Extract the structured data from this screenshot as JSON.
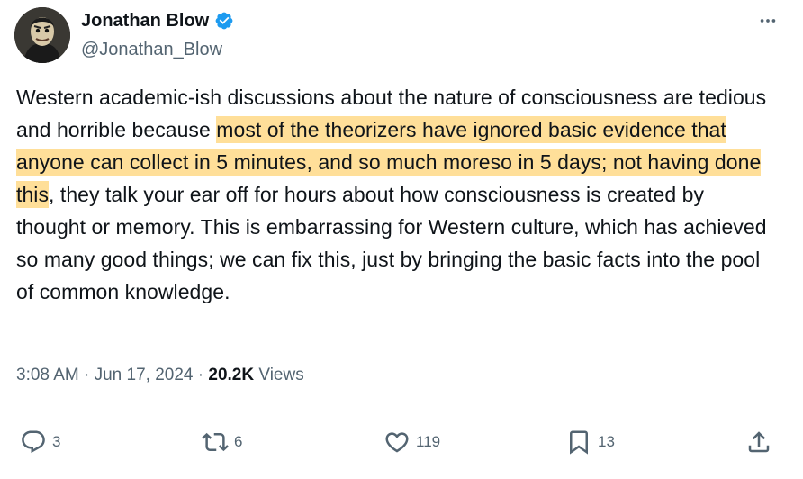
{
  "author": {
    "display_name": "Jonathan Blow",
    "handle": "@Jonathan_Blow",
    "verified_color": "#1d9bf0"
  },
  "tweet": {
    "text_before": "Western academic-ish discussions about the nature of consciousness are tedious and horrible because ",
    "text_highlight": "most of the theorizers have ignored basic evidence that anyone can collect in 5 minutes, and so much moreso in 5 days; not having done this",
    "text_after": ", they talk your ear off for hours about how consciousness is created by thought or memory. This is embarrassing for Western culture, which has achieved so many good things; we can fix this, just by bringing the basic facts into the pool of common knowledge.",
    "highlight_color": "#ffdf99"
  },
  "meta": {
    "time": "3:08 AM",
    "separator": "·",
    "date": "Jun 17, 2024",
    "views_count": "20.2K",
    "views_label": "Views"
  },
  "actions": {
    "replies": "3",
    "reposts": "6",
    "likes": "119",
    "bookmarks": "13"
  },
  "icons": [
    "verified-icon",
    "more-icon",
    "reply-icon",
    "repost-icon",
    "like-icon",
    "bookmark-icon",
    "share-icon"
  ]
}
